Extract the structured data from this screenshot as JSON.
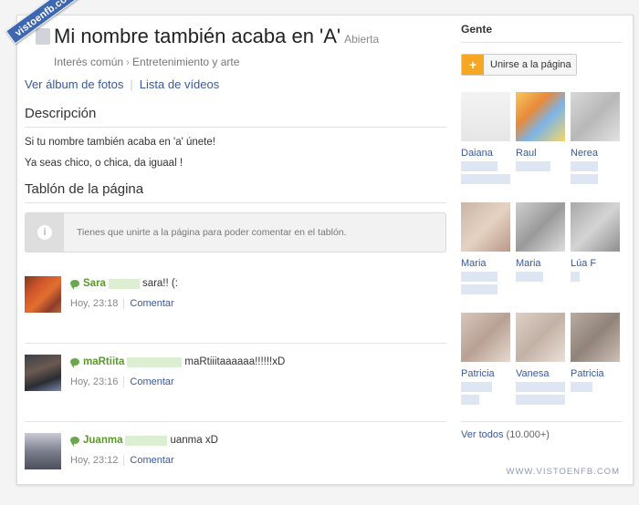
{
  "ribbon": "vistoenfb.com",
  "header": {
    "title": "Mi nombre también acaba en 'A'",
    "status": "Abierta",
    "breadcrumb": [
      "Interés común",
      "Entretenimiento y arte"
    ]
  },
  "links": [
    "Ver álbum de fotos",
    "Lista de vídeos"
  ],
  "description": {
    "title": "Descripción",
    "lines": [
      "Si tu nombre también acaba en 'a' únete!",
      "Ya seas chico, o chica, da iguaal !"
    ]
  },
  "wall": {
    "title": "Tablón de la página",
    "notice": "Tienes que unirte a la página para poder comentar en el tablón.",
    "comments": [
      {
        "author": "Sara",
        "text": "sara!! (:",
        "time": "Hoy, 23:18",
        "action": "Comentar"
      },
      {
        "author": "maRtiita",
        "text": "maRtiiitaaaaaa!!!!!!xD",
        "time": "Hoy, 23:16",
        "action": "Comentar"
      },
      {
        "author": "Juanma",
        "text": "uanma xD",
        "time": "Hoy, 23:12",
        "action": "Comentar"
      }
    ]
  },
  "sidebar": {
    "title": "Gente",
    "join_label": "Unirse a la página",
    "people": [
      "Daiana",
      "Raul",
      "Nerea",
      "Maria",
      "Maria",
      "Lúa F",
      "Patricia",
      "Vanesa",
      "Patricia"
    ],
    "see_all": "Ver todos",
    "count": "(10.000+)"
  },
  "watermark": "WWW.VISTOENFB.COM",
  "colors": {
    "link": "#3b5998",
    "author": "#5a9a2a",
    "join_accent": "#f5a623",
    "ribbon": "#3d67b1"
  }
}
